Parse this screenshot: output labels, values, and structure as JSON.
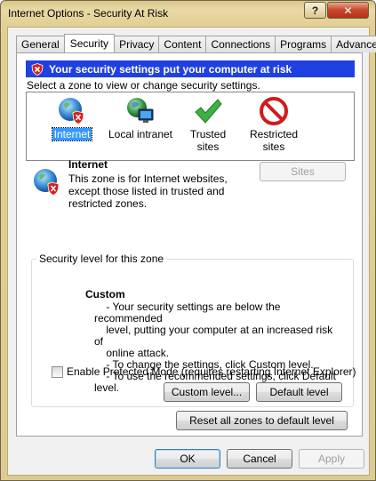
{
  "window": {
    "title": "Internet Options - Security At Risk",
    "help_label": "?",
    "close_label": "✕"
  },
  "tabs": [
    {
      "label": "General",
      "active": false
    },
    {
      "label": "Security",
      "active": true
    },
    {
      "label": "Privacy",
      "active": false
    },
    {
      "label": "Content",
      "active": false
    },
    {
      "label": "Connections",
      "active": false
    },
    {
      "label": "Programs",
      "active": false
    },
    {
      "label": "Advanced",
      "active": false
    }
  ],
  "security": {
    "alert": "Your security settings put your computer at risk",
    "select_zone_text": "Select a zone to view or change security settings.",
    "zones": [
      {
        "label": "Internet",
        "icon": "globe-shield-icon",
        "selected": true
      },
      {
        "label": "Local intranet",
        "icon": "globe-computer-icon",
        "selected": false
      },
      {
        "label": "Trusted sites",
        "icon": "green-check-icon",
        "selected": false
      },
      {
        "label": "Restricted sites",
        "icon": "red-no-entry-icon",
        "selected": false
      }
    ],
    "zone_info": {
      "name": "Internet",
      "description": "This zone is for Internet websites, except those listed in trusted and restricted zones."
    },
    "sites_button": "Sites",
    "level_group_title": "Security level for this zone",
    "level_name": "Custom",
    "level_description": [
      "    - Your security settings are below the recommended",
      "    level, putting your computer at an increased risk of",
      "    online attack.",
      "    - To change the settings, click Custom level.",
      "    - To use the recommended settings, click Default level."
    ],
    "protected_mode_label": "Enable Protected Mode (requires restarting Internet Explorer)",
    "protected_mode_checked": false,
    "custom_level_button": "Custom level...",
    "default_level_button": "Default level",
    "reset_button": "Reset all zones to default level"
  },
  "footer": {
    "ok": "OK",
    "cancel": "Cancel",
    "apply": "Apply"
  },
  "colors": {
    "alert_bg": "#1f41e0",
    "selection": "#3399ff",
    "title_bar": "#e2cf93"
  }
}
